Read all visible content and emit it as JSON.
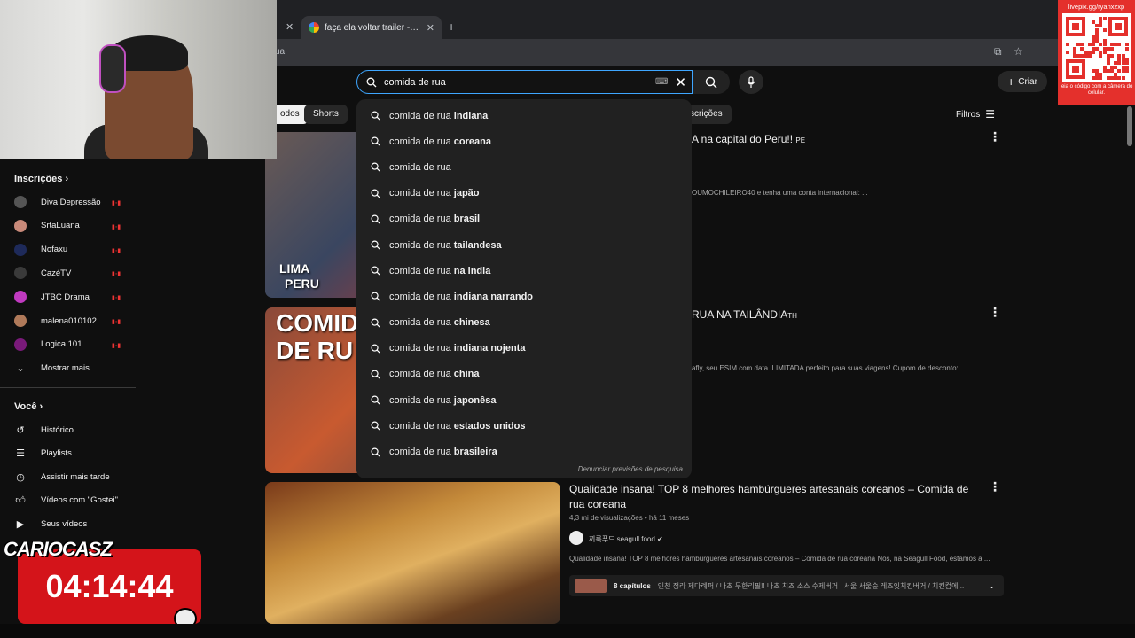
{
  "browser": {
    "tab_title": "faça ela voltar trailer - Pesquisa",
    "address_fragment": "ua"
  },
  "search": {
    "query": "comida de rua",
    "report_label": "Denunciar previsões de pesquisa"
  },
  "header": {
    "create_label": "Criar",
    "filters_label": "Filtros"
  },
  "chips": [
    {
      "label": "odos"
    },
    {
      "label": "Shorts"
    },
    {
      "label": "scrições"
    }
  ],
  "suggestions": [
    {
      "prefix": "comida de rua ",
      "bold": "indiana"
    },
    {
      "prefix": "comida de rua ",
      "bold": "coreana"
    },
    {
      "prefix": "comida de rua",
      "bold": ""
    },
    {
      "prefix": "comida de rua ",
      "bold": "japão"
    },
    {
      "prefix": "comida de rua ",
      "bold": "brasil"
    },
    {
      "prefix": "comida de rua ",
      "bold": "tailandesa"
    },
    {
      "prefix": "comida de rua ",
      "bold": "na india"
    },
    {
      "prefix": "comida de rua ",
      "bold": "indiana narrando"
    },
    {
      "prefix": "comida de rua ",
      "bold": "chinesa"
    },
    {
      "prefix": "comida de rua ",
      "bold": "indiana nojenta"
    },
    {
      "prefix": "comida de rua ",
      "bold": "china"
    },
    {
      "prefix": "comida de rua ",
      "bold": "japonêsa"
    },
    {
      "prefix": "comida de rua ",
      "bold": "estados unidos"
    },
    {
      "prefix": "comida de rua ",
      "bold": "brasileira"
    }
  ],
  "videos": [
    {
      "title_fragment": "A na capital do Peru!!",
      "flag": "PE",
      "desc_fragment": "OUMOCHILEIRO40 e tenha uma conta internacional: ...",
      "thumb_text": [
        "LIMA",
        "PERU"
      ]
    },
    {
      "title_fragment": "RUA NA TAILÂNDIA",
      "flag": "TH",
      "desc_fragment": "afly, seu ESIM com data ILIMITADA perfeito para suas viagens! Cupom de desconto: ...",
      "thumb_text": [
        "COMID",
        "DE RU"
      ]
    },
    {
      "title": "Qualidade insana! TOP 8 melhores hambúrgueres artesanais coreanos – Comida de rua coreana",
      "meta": "4,3 mi de visualizações • há 11 meses",
      "channel": "끼룩푸드 seagull food",
      "desc": "Qualidade insana! TOP 8 melhores hambúrgueres artesanais coreanos – Comida de rua coreana Nós, na Seagull Food, estamos a ...",
      "chapters_count": "8 capítulos",
      "chapters_text": "인천 정라 제다례퍼 / 나초 무한리필!! 나초 치즈 소스 수제버거 | 서울 서울숲 레즈잇치킨버거 / 치킨컵에..."
    }
  ],
  "sidebar": {
    "subs_header": "Inscrições",
    "subs": [
      {
        "name": "Diva Depressão",
        "color": "#555555"
      },
      {
        "name": "SrtaLuana",
        "color": "#c98a7a"
      },
      {
        "name": "Nofaxu",
        "color": "#1e2a5a"
      },
      {
        "name": "CazéTV",
        "color": "#3a3a3a"
      },
      {
        "name": "JTBC Drama",
        "color": "#c03ac0"
      },
      {
        "name": "malena010102",
        "color": "#b07a5a"
      },
      {
        "name": "Logica 101",
        "color": "#7a1a7a"
      }
    ],
    "show_more": "Mostrar mais",
    "you_header": "Você",
    "you_items": [
      {
        "label": "Histórico",
        "icon": "history-icon"
      },
      {
        "label": "Playlists",
        "icon": "playlist-icon"
      },
      {
        "label": "Assistir mais tarde",
        "icon": "clock-icon"
      },
      {
        "label": "Vídeos com \"Gostei\"",
        "icon": "thumbs-up-icon"
      },
      {
        "label": "Seus vídeos",
        "icon": "video-icon"
      }
    ]
  },
  "overlay": {
    "qr_url": "livepix.gg/ryanxzxp",
    "qr_caption": "leia o código com a câmera do celular.",
    "streamer_name": "CARIOCASZ",
    "timer": "04:14:44"
  },
  "colors": {
    "accent": "#3ea6ff",
    "timer_bg": "#d4141a",
    "qr_bg": "#e4302c"
  }
}
